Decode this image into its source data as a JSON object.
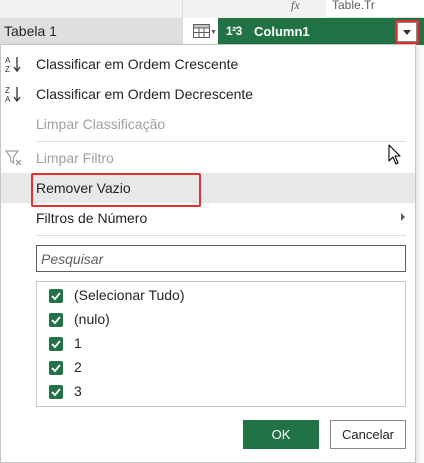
{
  "background": {
    "query_name": "Tabela 1",
    "formula_fx": "fx",
    "formula_text": "Table.Tr"
  },
  "column_header": {
    "type_icon_label": "1²3",
    "column_name": "Column1",
    "accent_color": "#217346"
  },
  "menu": {
    "items": [
      {
        "label": "Classificar em Ordem Crescente",
        "icon": "sort-ascending-icon",
        "enabled": true
      },
      {
        "label": "Classificar em Ordem Decrescente",
        "icon": "sort-descending-icon",
        "enabled": true
      },
      {
        "label": "Limpar Classificação",
        "icon": "",
        "enabled": false
      },
      {
        "label": "Limpar Filtro",
        "icon": "clear-filter-icon",
        "enabled": false
      },
      {
        "label": "Remover Vazio",
        "icon": "",
        "enabled": true,
        "highlighted": true
      },
      {
        "label": "Filtros de Número",
        "icon": "",
        "enabled": true,
        "has_submenu": true
      }
    ],
    "search_placeholder": "Pesquisar",
    "checklist": [
      {
        "label": "(Selecionar Tudo)",
        "checked": true
      },
      {
        "label": "(nulo)",
        "checked": true
      },
      {
        "label": "1",
        "checked": true
      },
      {
        "label": "2",
        "checked": true
      },
      {
        "label": "3",
        "checked": true
      }
    ],
    "ok_label": "OK",
    "cancel_label": "Cancelar"
  },
  "colors": {
    "highlight_border": "#e03030",
    "hover_row": "#e8e8e8"
  }
}
